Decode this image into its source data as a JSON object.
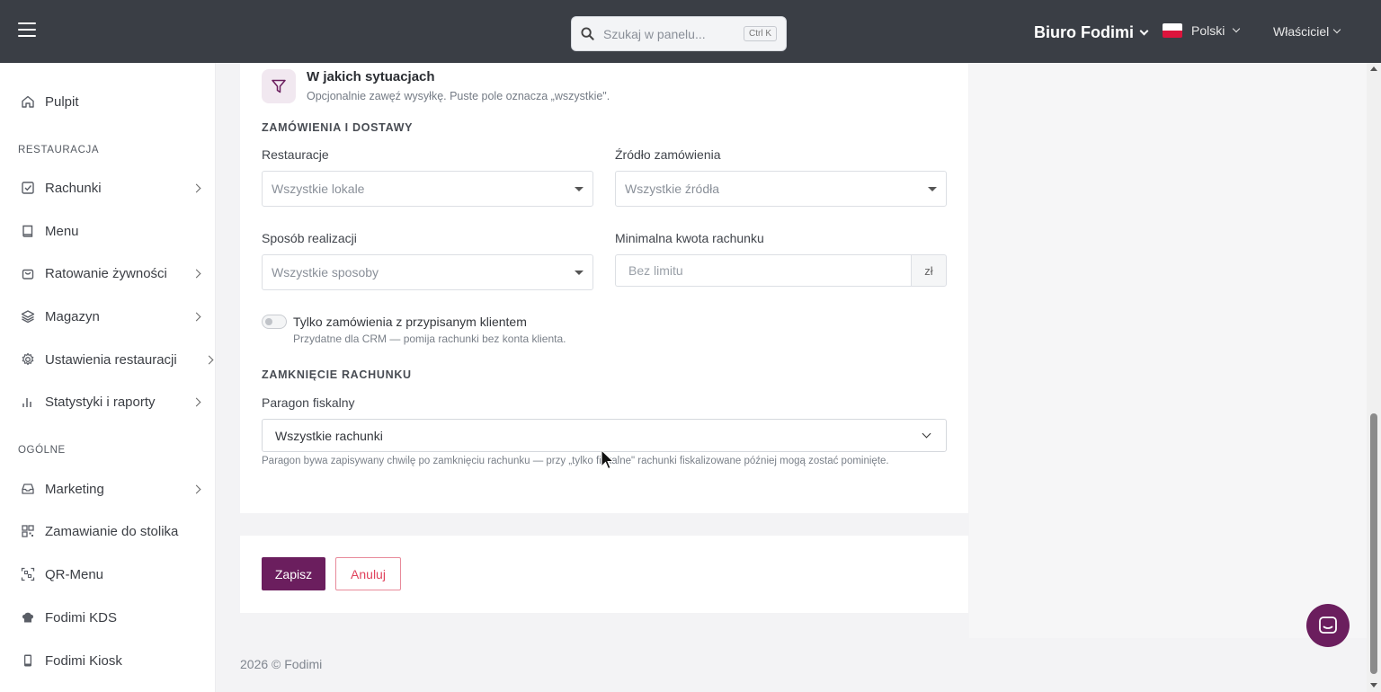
{
  "topbar": {
    "search_placeholder": "Szukaj w panelu...",
    "search_shortcut": "Ctrl K",
    "org_name": "Biuro Fodimi",
    "language": "Polski",
    "role": "Właściciel"
  },
  "sidebar": {
    "dashboard": "Pulpit",
    "section_restaurant": "RESTAURACJA",
    "section_general": "OGÓLNE",
    "items": {
      "bills": "Rachunki",
      "menu": "Menu",
      "food_rescue": "Ratowanie żywności",
      "warehouse": "Magazyn",
      "restaurant_settings": "Ustawienia restauracji",
      "stats": "Statystyki i raporty",
      "marketing": "Marketing",
      "table_ordering": "Zamawianie do stolika",
      "qr_menu": "QR-Menu",
      "kds": "Fodimi KDS",
      "kiosk": "Fodimi Kiosk"
    }
  },
  "form": {
    "section_title": "W jakich sytuacjach",
    "section_subtitle": "Opcjonalnie zawęź wysyłkę. Puste pole oznacza „wszystkie\".",
    "group_orders": "ZAMÓWIENIA I DOSTAWY",
    "restaurants_label": "Restauracje",
    "restaurants_value": "Wszystkie lokale",
    "source_label": "Źródło zamówienia",
    "source_value": "Wszystkie źródła",
    "fulfillment_label": "Sposób realizacji",
    "fulfillment_value": "Wszystkie sposoby",
    "min_amount_label": "Minimalna kwota rachunku",
    "min_amount_placeholder": "Bez limitu",
    "currency": "zł",
    "toggle_label": "Tylko zamówienia z przypisanym klientem",
    "toggle_hint": "Przydatne dla CRM — pomija rachunki bez konta klienta.",
    "group_closing": "ZAMKNIĘCIE RACHUNKU",
    "receipt_label": "Paragon fiskalny",
    "receipt_value": "Wszystkie rachunki",
    "receipt_hint": "Paragon bywa zapisywany chwilę po zamknięciu rachunku — przy „tylko fiskalne\" rachunki fiskalizowane później mogą zostać pominięte."
  },
  "actions": {
    "save": "Zapisz",
    "cancel": "Anuluj"
  },
  "footer": {
    "copyright": "2026 © Fodimi"
  },
  "colors": {
    "topbar": "#3a3e45",
    "primary": "#6b1e5e",
    "danger": "#e0425c"
  }
}
